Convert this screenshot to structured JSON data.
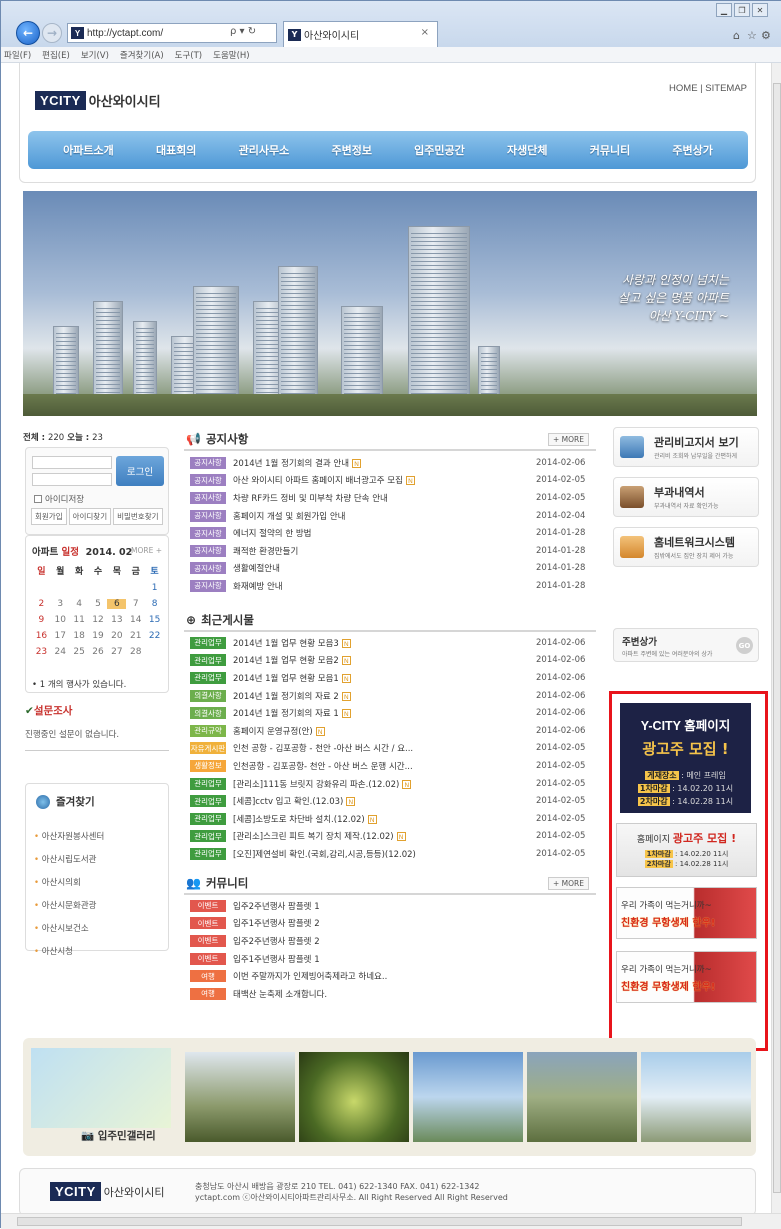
{
  "browser": {
    "url": "http://yctapt.com/",
    "tab_title": "아산와이시티",
    "search_ctl": "ρ ▾ ↻",
    "menus": [
      "파일(F)",
      "편집(E)",
      "보기(V)",
      "즐겨찾기(A)",
      "도구(T)",
      "도움말(H)"
    ]
  },
  "header": {
    "logo_mark": "YCITY",
    "logo_text": "아산와이시티",
    "top_links": "HOME  |  SITEMAP",
    "nav": [
      "아파트소개",
      "대표회의",
      "관리사무소",
      "주변정보",
      "입주민공간",
      "자생단체",
      "커뮤니티",
      "주변상가"
    ]
  },
  "hero": {
    "slogan1": "사랑과 인정이 넘치는",
    "slogan2": "살고 싶은 명품 아파트",
    "slogan3": "아산 Y-CITY ~"
  },
  "stats": {
    "total_label": "전체 : ",
    "total": "220",
    "today_label": " 오늘 : ",
    "today": "23"
  },
  "login": {
    "button": "로그인",
    "save_id": "아이디저장",
    "buttons": [
      "회원가입",
      "아이디찾기",
      "비밀번호찾기"
    ]
  },
  "calendar": {
    "label": "아파트 ",
    "label_red": "일정",
    "month": "2014. 02",
    "more": "MORE +",
    "dow": [
      "일",
      "월",
      "화",
      "수",
      "목",
      "금",
      "토"
    ],
    "days": [
      "",
      "",
      "",
      "",
      "",
      "",
      "1",
      "2",
      "3",
      "4",
      "5",
      "6",
      "7",
      "8",
      "9",
      "10",
      "11",
      "12",
      "13",
      "14",
      "15",
      "16",
      "17",
      "18",
      "19",
      "20",
      "21",
      "22",
      "23",
      "24",
      "25",
      "26",
      "27",
      "28",
      ""
    ],
    "today": "6",
    "note": "• 1 개의 행사가 있습니다."
  },
  "survey": {
    "title": "설문조사",
    "body": "진행중인 설문이 없습니다."
  },
  "favorites": {
    "title": "즐겨찾기",
    "items": [
      "아산자원봉사센터",
      "아산시립도서관",
      "아산시의회",
      "아산시문화관광",
      "아산시보건소",
      "아산시청"
    ]
  },
  "notice": {
    "title": "공지사항",
    "more": "+ MORE",
    "rows": [
      {
        "tag": "공지사항",
        "title": "2014년 1월 정기회의 결과 안내",
        "new": "N",
        "date": "2014-02-06"
      },
      {
        "tag": "공지사항",
        "title": "아산 와이시티 아파트 홈페이지 배너광고주 모집",
        "new": "N",
        "date": "2014-02-05"
      },
      {
        "tag": "공지사항",
        "title": "차량 RF카드 정비 및 미부착 차량 단속 안내",
        "new": "",
        "date": "2014-02-05"
      },
      {
        "tag": "공지사항",
        "title": "홈페이지 개설 및 회원가입 안내",
        "new": "",
        "date": "2014-02-04"
      },
      {
        "tag": "공지사항",
        "title": "에너지 절약의 한 방법",
        "new": "",
        "date": "2014-01-28"
      },
      {
        "tag": "공지사항",
        "title": "쾌적한 환경만들기",
        "new": "",
        "date": "2014-01-28"
      },
      {
        "tag": "공지사항",
        "title": "생활예절안내",
        "new": "",
        "date": "2014-01-28"
      },
      {
        "tag": "공지사항",
        "title": "화재예방 안내",
        "new": "",
        "date": "2014-01-28"
      }
    ]
  },
  "recent": {
    "title": "최근게시물",
    "rows": [
      {
        "tag": "관리업무",
        "cls": "tg-mgmt",
        "title": "2014년 1월 업무 현황 모음3",
        "new": "N",
        "date": "2014-02-06"
      },
      {
        "tag": "관리업무",
        "cls": "tg-mgmt",
        "title": "2014년 1월 업무 현황 모음2",
        "new": "N",
        "date": "2014-02-06"
      },
      {
        "tag": "관리업무",
        "cls": "tg-mgmt",
        "title": "2014년 1월 업무 현황 모음1",
        "new": "N",
        "date": "2014-02-06"
      },
      {
        "tag": "의결사항",
        "cls": "tg-council",
        "title": "2014년 1월 정기회의 자료 2",
        "new": "N",
        "date": "2014-02-06"
      },
      {
        "tag": "의결사항",
        "cls": "tg-council",
        "title": "2014년 1월 정기회의 자료 1",
        "new": "N",
        "date": "2014-02-06"
      },
      {
        "tag": "관리규약",
        "cls": "tg-rule",
        "title": "홈페이지 운영규정(안)",
        "new": "N",
        "date": "2014-02-06"
      },
      {
        "tag": "자유게시판",
        "cls": "tg-free",
        "title": "인천 공항 - 김포공항 - 천안 -아산 버스 시간 / 요...",
        "new": "",
        "date": "2014-02-05"
      },
      {
        "tag": "생활정보",
        "cls": "tg-life",
        "title": "인천공항 - 김포공항- 천안 - 아산 버스 운행 시간...",
        "new": "",
        "date": "2014-02-05"
      },
      {
        "tag": "관리업무",
        "cls": "tg-mgmt",
        "title": "[관리소]111동 브릿지 강화유리 파손.(12.02)",
        "new": "N",
        "date": "2014-02-05"
      },
      {
        "tag": "관리업무",
        "cls": "tg-mgmt",
        "title": "[세콤]cctv 입고 확인.(12.03)",
        "new": "N",
        "date": "2014-02-05"
      },
      {
        "tag": "관리업무",
        "cls": "tg-mgmt",
        "title": "[세콤]소방도로 차단바 설치.(12.02)",
        "new": "N",
        "date": "2014-02-05"
      },
      {
        "tag": "관리업무",
        "cls": "tg-mgmt",
        "title": "[관리소]스크린 피트 복기 장치 제작.(12.02)",
        "new": "N",
        "date": "2014-02-05"
      },
      {
        "tag": "관리업무",
        "cls": "tg-mgmt",
        "title": "[오진]제연설비 확인.(국회,감리,시공,등등)(12.02)",
        "new": "",
        "date": "2014-02-05"
      }
    ]
  },
  "community": {
    "title": "커뮤니티",
    "more": "+ MORE",
    "rows": [
      {
        "tag": "이벤트",
        "cls": "tg-event",
        "title": "입주2주년행사 팜플렛 1"
      },
      {
        "tag": "이벤트",
        "cls": "tg-event",
        "title": "입주1주년행사 팜플렛 2"
      },
      {
        "tag": "이벤트",
        "cls": "tg-event",
        "title": "입주2주년행사 팜플렛 2"
      },
      {
        "tag": "이벤트",
        "cls": "tg-event",
        "title": "입주1주년행사 팜플렛 1"
      },
      {
        "tag": "여행",
        "cls": "tg-travel",
        "title": "이번 주말까지가 인제빙어축제라고 하네요.."
      },
      {
        "tag": "여행",
        "cls": "tg-travel",
        "title": "태백산 눈축제 소개합니다."
      }
    ]
  },
  "sidebar": {
    "items": [
      {
        "title": "관리비고지서 보기",
        "sub": "관리비 조회와 납부일을 간편하게"
      },
      {
        "title": "부과내역서",
        "sub": "부과내역서 자료 확인가능"
      },
      {
        "title": "홈네트워크시스템",
        "sub": "집밖에서도 집안 장치 제어 가능"
      }
    ],
    "shop_title": "주변상가",
    "shop_sub": "아파트 주변에 있는 여러분야의 상가",
    "shop_go": "GO"
  },
  "ads": {
    "ad1_a": "Y-CITY 홈페이지",
    "ad1_b": "광고주 모집 !",
    "ad1_l1k": "게재장소",
    "ad1_l1v": " : 메인 프레임",
    "ad1_l2k": "1차마감",
    "ad1_l2v": " : 14.02.20 11시",
    "ad1_l3k": "2차마감",
    "ad1_l3v": " : 14.02.28 11시",
    "ad2_a": "홈페이지 ",
    "ad2_b": "광고주 모집 !",
    "ad2_l1k": "1차마감",
    "ad2_l1v": " : 14.02.20 11시",
    "ad2_l2k": "2차마감",
    "ad2_l2v": " : 14.02.28 11시",
    "ad3_a": "우리 가족이 먹는거니까~",
    "ad3_b": "친환경 무항생제 한우!"
  },
  "gallery": {
    "title": "입주민갤러리"
  },
  "footer": {
    "line1": "충청남도 아산시 배방읍 광장로 210    TEL. 041) 622-1340    FAX. 041) 622-1342",
    "line2": "yctapt.com ⓒ아산와이시티아파트관리사무소. All Right Reserved All Right Reserved"
  }
}
